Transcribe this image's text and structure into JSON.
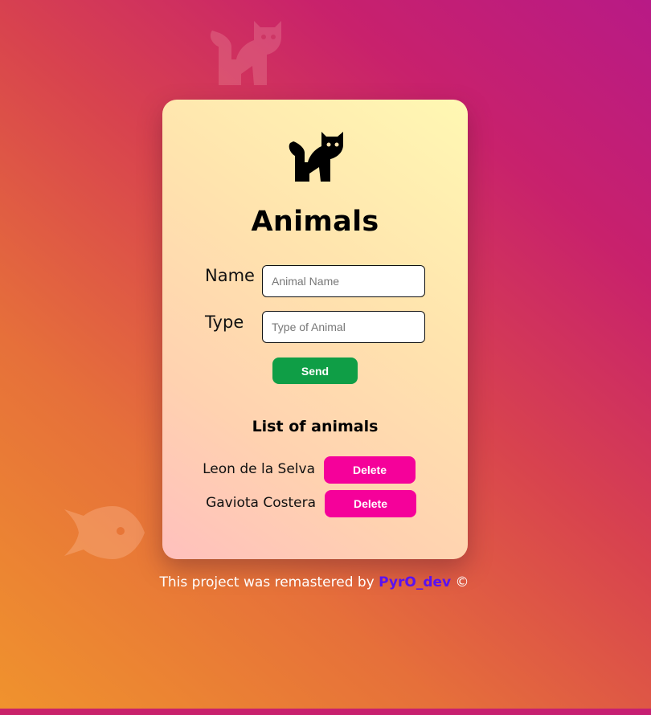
{
  "card": {
    "title": "Animals",
    "form": {
      "name_label": "Name",
      "name_placeholder": "Animal Name",
      "type_label": "Type",
      "type_placeholder": "Type of Animal",
      "send_label": "Send"
    },
    "list": {
      "title": "List of animals",
      "delete_label": "Delete",
      "items": [
        {
          "name": "Leon de la Selva"
        },
        {
          "name": "Gaviota Costera"
        }
      ]
    }
  },
  "footer": {
    "text": "This project was remastered by",
    "author": "PyrO_dev",
    "copyright": "©"
  },
  "icons": {
    "card_logo": "cat-icon",
    "background": [
      "cat-icon",
      "fish-icon"
    ]
  },
  "colors": {
    "send_button": "#0f9e46",
    "delete_button": "#f5019a",
    "author_link": "#5a12f0"
  }
}
